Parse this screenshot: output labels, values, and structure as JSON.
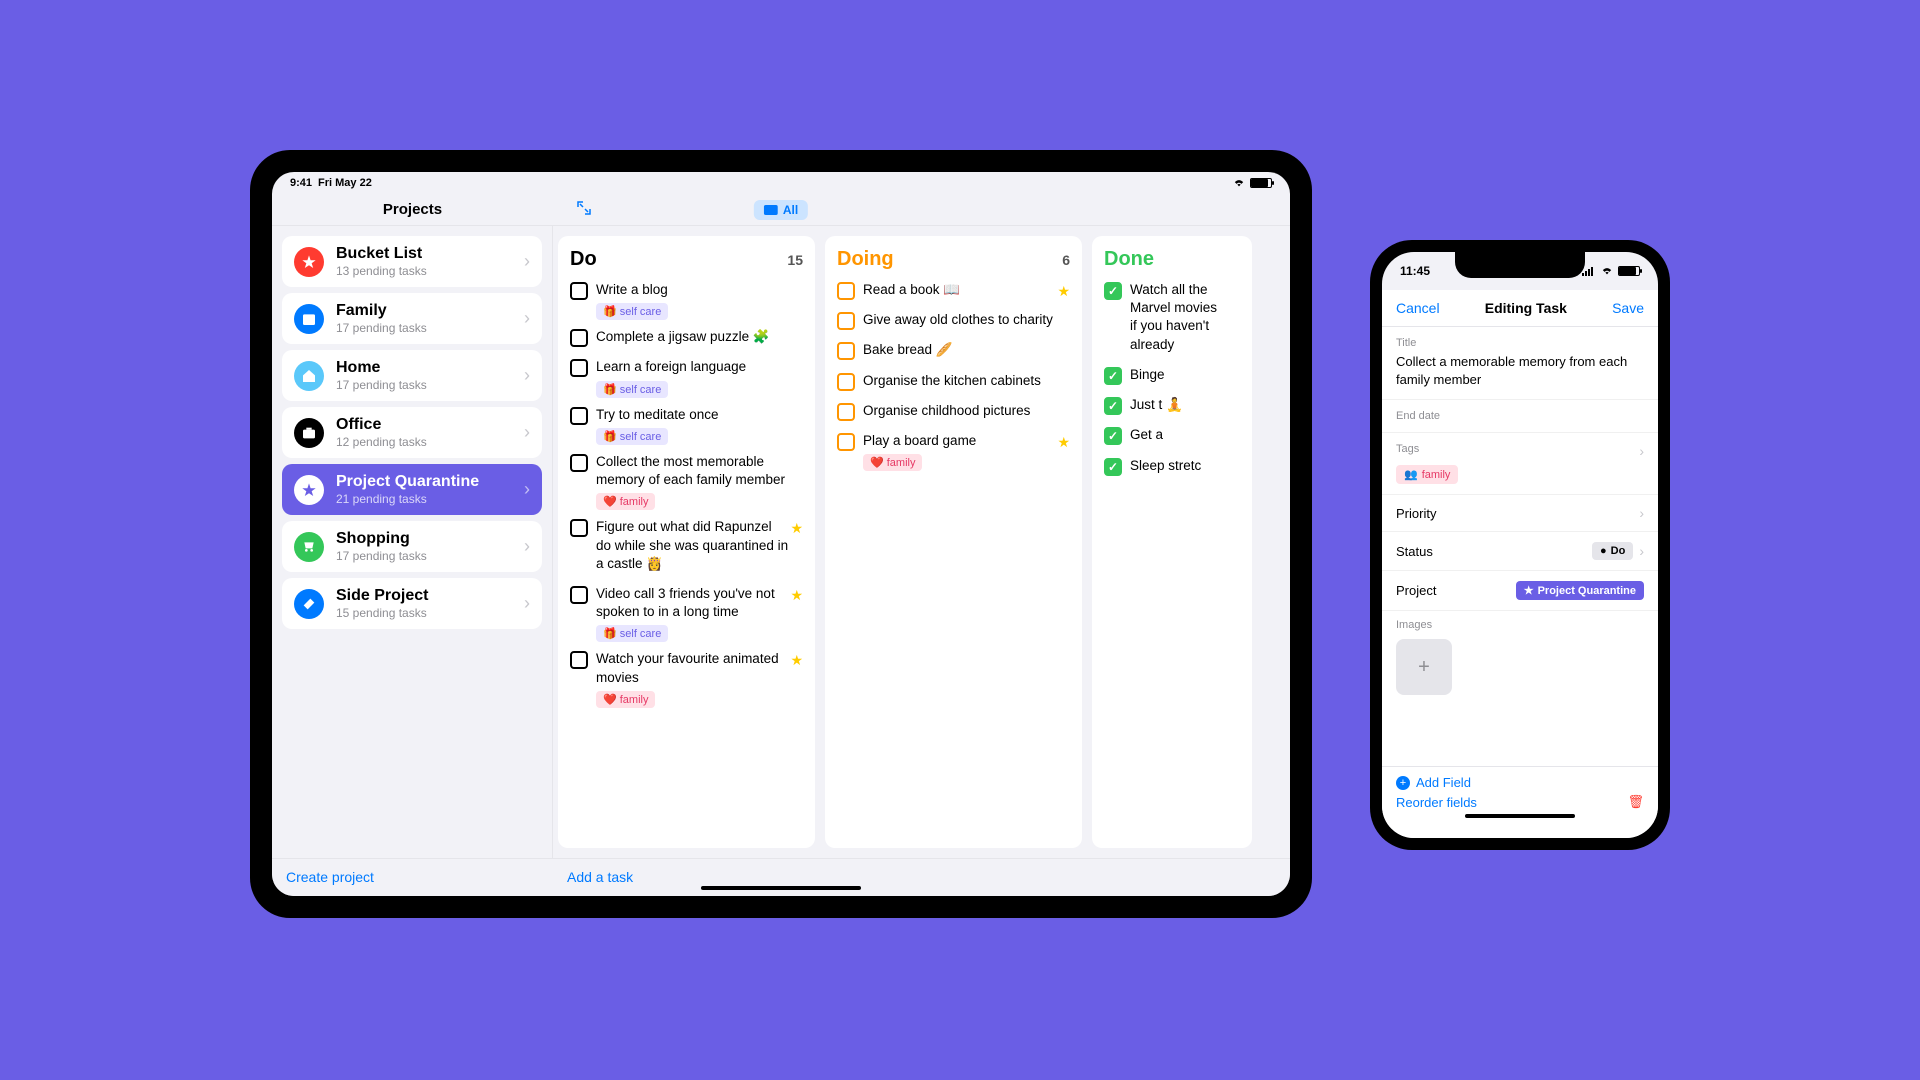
{
  "ipad": {
    "status": {
      "time": "9:41",
      "date": "Fri May 22"
    },
    "header": {
      "title": "Projects",
      "pill_label": "All",
      "expand_icon": "↘↖"
    },
    "sidebar": {
      "projects": [
        {
          "name": "Bucket List",
          "sub": "13 pending tasks",
          "color": "#FF3B30",
          "icon": "star"
        },
        {
          "name": "Family",
          "sub": "17 pending tasks",
          "color": "#007AFF",
          "icon": "calendar"
        },
        {
          "name": "Home",
          "sub": "17 pending tasks",
          "color": "#5AC8FA",
          "icon": "home"
        },
        {
          "name": "Office",
          "sub": "12 pending tasks",
          "color": "#000000",
          "icon": "briefcase"
        },
        {
          "name": "Project Quarantine",
          "sub": "21 pending tasks",
          "color": "#fff",
          "icon": "star",
          "active": true
        },
        {
          "name": "Shopping",
          "sub": "17 pending tasks",
          "color": "#34C759",
          "icon": "cart"
        },
        {
          "name": "Side Project",
          "sub": "15 pending tasks",
          "color": "#007AFF",
          "icon": "tools"
        }
      ]
    },
    "columns": {
      "do": {
        "title": "Do",
        "count": "15",
        "title_color": "#000",
        "tasks": [
          {
            "title": "Write a blog",
            "tags": [
              "selfcare"
            ]
          },
          {
            "title": "Complete a jigsaw puzzle 🧩"
          },
          {
            "title": "Learn a foreign language",
            "tags": [
              "selfcare"
            ]
          },
          {
            "title": "Try to meditate once",
            "tags": [
              "selfcare"
            ]
          },
          {
            "title": "Collect the most memorable memory of each family member",
            "tags": [
              "family"
            ]
          },
          {
            "title": "Figure out what did Rapunzel do while she was quarantined in a castle 👸",
            "star": true
          },
          {
            "title": "Video call 3 friends you've not spoken to in a long time",
            "star": true,
            "tags": [
              "selfcare"
            ]
          },
          {
            "title": "Watch your favourite animated movies",
            "star": true,
            "tags": [
              "family"
            ]
          }
        ]
      },
      "doing": {
        "title": "Doing",
        "count": "6",
        "title_color": "#FF9500",
        "tasks": [
          {
            "title": "Read a book 📖",
            "star": true
          },
          {
            "title": "Give away old clothes to charity"
          },
          {
            "title": "Bake bread 🥖"
          },
          {
            "title": "Organise the kitchen cabinets"
          },
          {
            "title": "Organise childhood pictures"
          },
          {
            "title": "Play a board game",
            "star": true,
            "tags": [
              "family"
            ]
          }
        ]
      },
      "done": {
        "title": "Done",
        "count": "",
        "title_color": "#34C759",
        "tasks": [
          {
            "title": "Watch all the Marvel movies if you haven't already"
          },
          {
            "title": "Binge"
          },
          {
            "title": "Just t 🧘"
          },
          {
            "title": "Get a"
          },
          {
            "title": "Sleep stretc"
          }
        ]
      }
    },
    "footer": {
      "create_project": "Create project",
      "add_task": "Add a task"
    },
    "tag_labels": {
      "selfcare": "self care",
      "family": "family"
    }
  },
  "iphone": {
    "status_time": "11:45",
    "header": {
      "cancel": "Cancel",
      "title": "Editing Task",
      "save": "Save"
    },
    "form": {
      "title_label": "Title",
      "title_value": "Collect a memorable memory from each family member",
      "end_date_label": "End date",
      "tags_label": "Tags",
      "tag_family": "family",
      "priority_label": "Priority",
      "status_label": "Status",
      "status_value": "Do",
      "project_label": "Project",
      "project_value": "Project Quarantine",
      "images_label": "Images"
    },
    "footer": {
      "add_field": "Add Field",
      "reorder": "Reorder fields"
    }
  }
}
